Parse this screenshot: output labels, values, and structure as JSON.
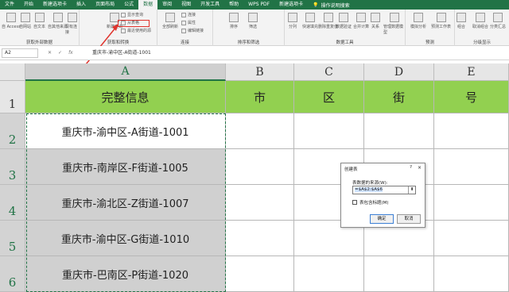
{
  "tabs": [
    "文件",
    "开始",
    "新建选项卡",
    "插入",
    "页面布局",
    "公式",
    "数据",
    "审阅",
    "视图",
    "开发工具",
    "帮助",
    "WPS PDF",
    "新建选项卡"
  ],
  "active_tab_index": 6,
  "tell_me": "操作说明搜索",
  "ribbon": {
    "get_external_group": "获取外部数据",
    "get_external_btns": [
      "自 Access",
      "自网站",
      "自文本",
      "自其他来源",
      "现有连接"
    ],
    "transform_small": [
      "显示查询",
      "从表格",
      "最近使用的源"
    ],
    "transform_group": "获取和转换",
    "new_query": "新建查询",
    "connections_group": "连接",
    "connections_small": [
      "连接",
      "属性",
      "编辑链接"
    ],
    "refresh_all": "全部刷新",
    "sort_filter_group": "排序和筛选",
    "sort_btns": [
      "排序",
      "筛选"
    ],
    "data_tools_group": "数据工具",
    "data_tools_btns": [
      "分列",
      "快速填充",
      "删除重复值",
      "数据验证",
      "合并计算",
      "关系",
      "管理数据模型"
    ],
    "forecast_group": "预测",
    "forecast_btns": [
      "模拟分析",
      "预测工作表"
    ],
    "outline_group": "分级显示",
    "outline_btns": [
      "组合",
      "取消组合",
      "分类汇总"
    ]
  },
  "formula_bar": {
    "name_box": "A2",
    "content": "重庆市-渝中区-A街道-1001"
  },
  "columns": [
    "A",
    "B",
    "C",
    "D",
    "E"
  ],
  "rows": [
    "1",
    "2",
    "3",
    "4",
    "5",
    "6"
  ],
  "header_row": [
    "完整信息",
    "市",
    "区",
    "街",
    "号"
  ],
  "data_rows": [
    "重庆市-渝中区-A街道-1001",
    "重庆市-南岸区-F街道-1005",
    "重庆市-渝北区-Z街道-1007",
    "重庆市-渝中区-G街道-1010",
    "重庆市-巴南区-P街道-1020"
  ],
  "dialog": {
    "title": "创建表",
    "help": "?",
    "close": "×",
    "label": "表数据的来源(W):",
    "range": "=$A$2:$A$6",
    "checkbox": "表包含标题(M)",
    "ok": "确定",
    "cancel": "取消"
  },
  "colors": {
    "excel_green": "#217346",
    "header_fill": "#92d050",
    "selected_fill": "#d0d0d0",
    "highlight_red": "#e0332c"
  }
}
